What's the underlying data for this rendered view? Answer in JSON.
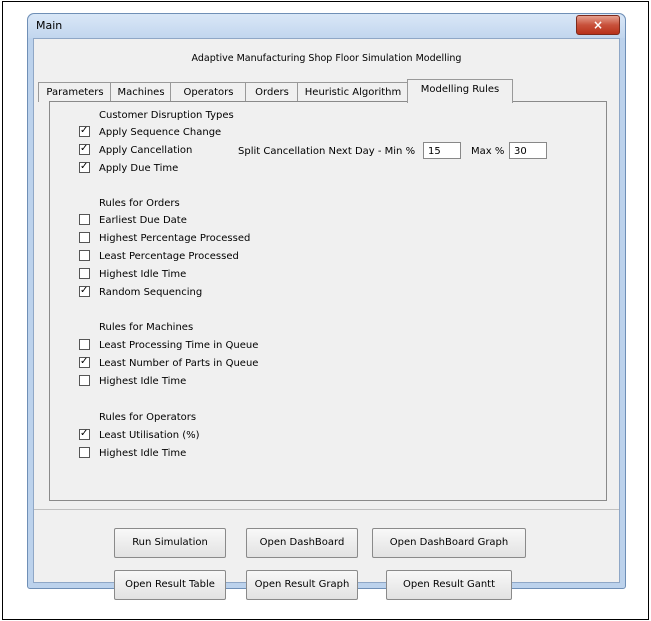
{
  "window": {
    "title": "Main",
    "close_glyph": "×"
  },
  "app_title": "Adaptive Manufacturing Shop Floor Simulation Modelling",
  "tabs": [
    "Parameters",
    "Machines",
    "Operators",
    "Orders",
    "Heuristic Algorithm",
    "Modelling Rules"
  ],
  "active_tab": "Modelling Rules",
  "disruption": {
    "header": "Customer Disruption Types",
    "items": [
      {
        "label": "Apply Sequence Change",
        "checked": true
      },
      {
        "label": "Apply Cancellation",
        "checked": true
      },
      {
        "label": "Apply Due Time",
        "checked": true
      }
    ],
    "split_label": "Split Cancellation Next Day - Min %",
    "min_value": "15",
    "max_label": "Max %",
    "max_value": "30"
  },
  "orders": {
    "header": "Rules for Orders",
    "items": [
      {
        "label": "Earliest Due Date",
        "checked": false
      },
      {
        "label": "Highest Percentage Processed",
        "checked": false
      },
      {
        "label": "Least Percentage Processed",
        "checked": false
      },
      {
        "label": "Highest Idle Time",
        "checked": false
      },
      {
        "label": "Random Sequencing",
        "checked": true
      }
    ]
  },
  "machines": {
    "header": "Rules for Machines",
    "items": [
      {
        "label": "Least Processing Time in Queue",
        "checked": false
      },
      {
        "label": "Least Number of Parts in Queue",
        "checked": true
      },
      {
        "label": "Highest Idle Time",
        "checked": false
      }
    ]
  },
  "operators": {
    "header": "Rules for Operators",
    "items": [
      {
        "label": "Least Utilisation (%)",
        "checked": true
      },
      {
        "label": "Highest Idle Time",
        "checked": false
      }
    ]
  },
  "buttons": {
    "run_simulation": "Run Simulation",
    "open_dashboard": "Open DashBoard",
    "open_dashboard_graph": "Open DashBoard Graph",
    "open_result_table": "Open Result Table",
    "open_result_graph": "Open Result Graph",
    "open_result_gantt": "Open Result Gantt"
  },
  "icons": {
    "close": "close-icon",
    "checkbox": "checkmark-icon"
  }
}
